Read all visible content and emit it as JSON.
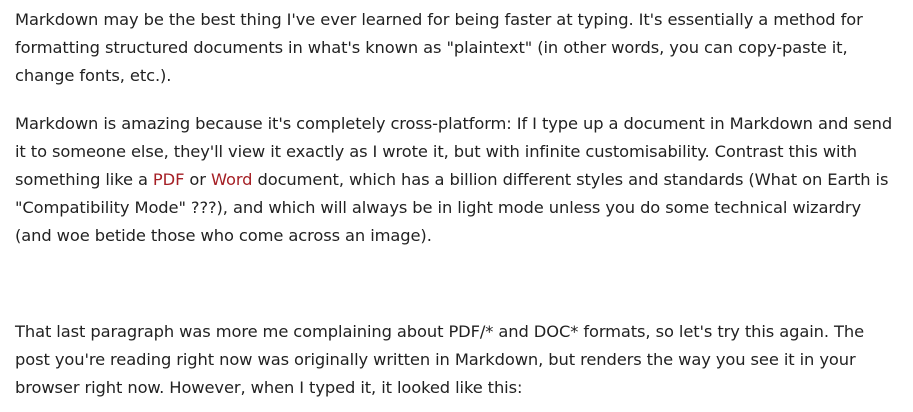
{
  "article": {
    "paragraph_1": "Markdown may be the best thing I've ever learned for being faster at typing. It's essentially a method for formatting structured documents in what's known as \"plaintext\" (in other words, you can copy-paste it, change fonts, etc.).",
    "paragraph_2": {
      "before_pdf": "Markdown is amazing because it's completely cross-platform: If I type up a document in Markdown and send it to someone else, they'll view it exactly as I wrote it, but with infinite customisability. Contrast this with something like a ",
      "pdf_link": "PDF",
      "between_links": " or ",
      "word_link": "Word",
      "after_word": " document, which has a billion different styles and standards (What on Earth is \"Compatibility Mode\" ???), and which will always be in light mode unless you do some technical wizardry (and woe betide those who come across an image)."
    },
    "paragraph_3": "That last paragraph was more me complaining about PDF/* and DOC* formats, so let's try this again. The post you're reading right now was originally written in Markdown, but renders the way you see it in your browser right now. However, when I typed it, it looked like this:"
  },
  "colors": {
    "text": "#222222",
    "link": "#a51f25",
    "background": "#ffffff"
  }
}
